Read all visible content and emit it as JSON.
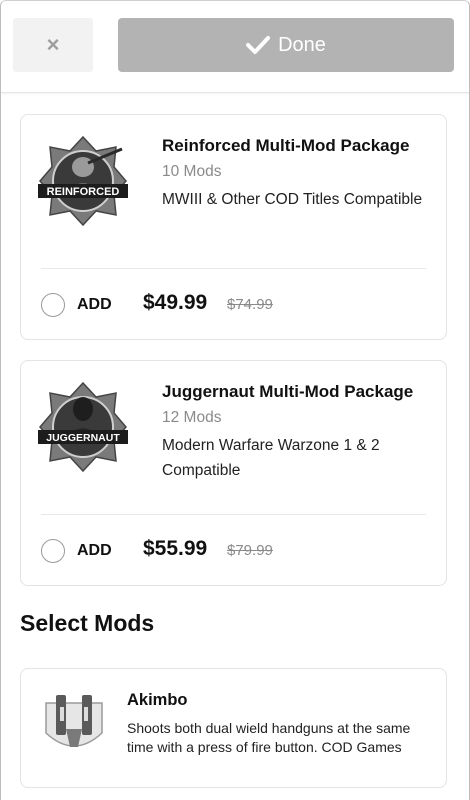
{
  "header": {
    "close_label": "×",
    "done_label": "Done"
  },
  "packages": [
    {
      "badge_text": "REINFORCED",
      "title": "Reinforced Multi-Mod Package",
      "mods_count": "10 Mods",
      "compatibility": "MWIII & Other COD Titles Compatible",
      "add_label": "ADD",
      "price": "$49.99",
      "original_price": "$74.99"
    },
    {
      "badge_text": "JUGGERNAUT",
      "title": "Juggernaut Multi-Mod Package",
      "mods_count": "12 Mods",
      "compatibility": "Modern Warfare Warzone 1 & 2 Compatible",
      "add_label": "ADD",
      "price": "$55.99",
      "original_price": "$79.99"
    }
  ],
  "select_mods": {
    "heading": "Select Mods",
    "items": [
      {
        "name": "Akimbo",
        "description": "Shoots both dual wield handguns at the same time with a press of fire button. COD Games"
      }
    ]
  }
}
